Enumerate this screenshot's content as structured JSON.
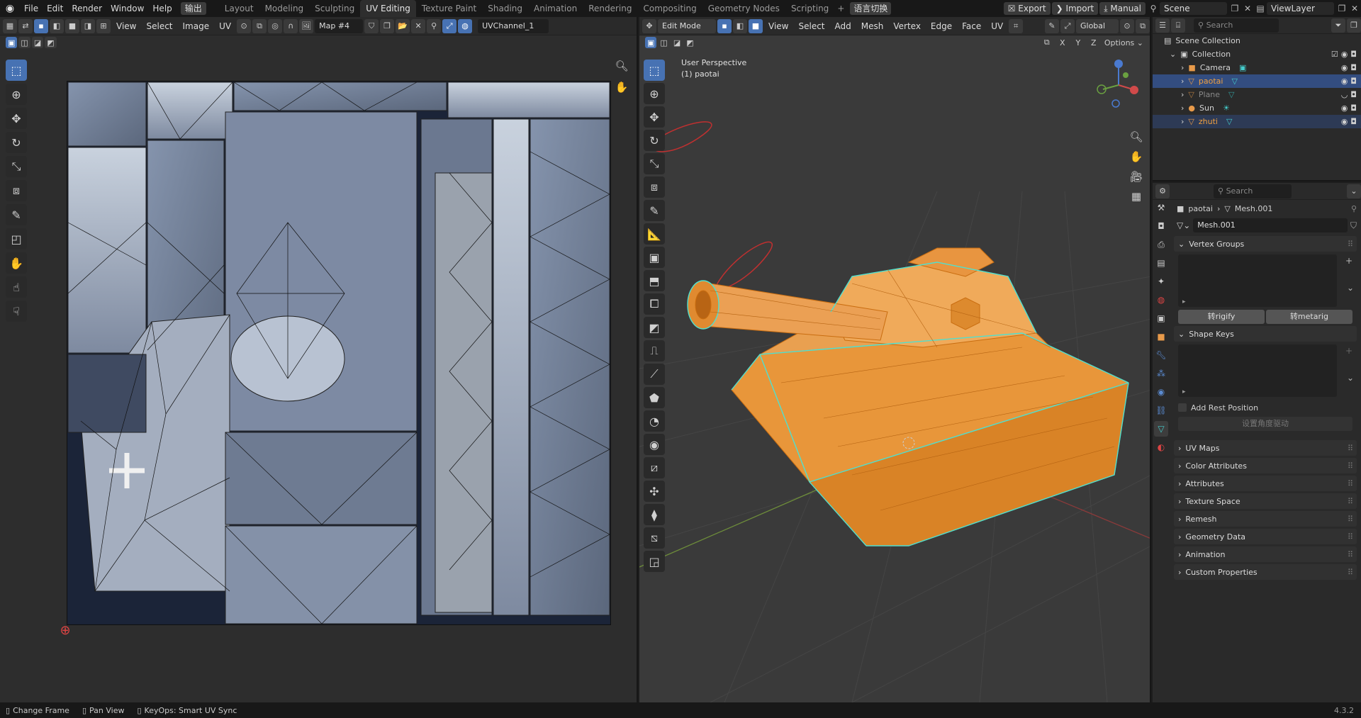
{
  "topbar": {
    "menus": [
      "File",
      "Edit",
      "Render",
      "Window",
      "Help"
    ],
    "special_menu": "输出",
    "workspaces": [
      "Layout",
      "Modeling",
      "Sculpting",
      "UV Editing",
      "Texture Paint",
      "Shading",
      "Animation",
      "Rendering",
      "Compositing",
      "Geometry Nodes",
      "Scripting"
    ],
    "active_workspace": "UV Editing",
    "lang_button": "语言切换",
    "export": "Export",
    "import": "Import",
    "manual": "Manual",
    "scene": "Scene",
    "viewlayer": "ViewLayer"
  },
  "uv_editor": {
    "menus": [
      "View",
      "Select",
      "Image",
      "UV"
    ],
    "image_name": "Map #4",
    "uv_channel": "UVChannel_1"
  },
  "viewport": {
    "mode": "Edit Mode",
    "menus": [
      "View",
      "Select",
      "Add",
      "Mesh",
      "Vertex",
      "Edge",
      "Face",
      "UV"
    ],
    "orientation": "Global",
    "options": "Options",
    "axes": [
      "X",
      "Y",
      "Z"
    ],
    "perspective_label": "User Perspective",
    "object_label": "(1) paotai"
  },
  "outliner": {
    "search_placeholder": "Search",
    "scene_collection": "Scene Collection",
    "collection": "Collection",
    "items": [
      {
        "name": "Camera",
        "selected": false,
        "color": "#d4d4d4"
      },
      {
        "name": "paotai",
        "selected": true,
        "color": "#f0a040"
      },
      {
        "name": "Plane",
        "selected": false,
        "color": "#888888"
      },
      {
        "name": "Sun",
        "selected": false,
        "color": "#d4d4d4"
      },
      {
        "name": "zhuti",
        "selected": false,
        "color": "#f0a040"
      }
    ]
  },
  "properties": {
    "search_placeholder": "Search",
    "breadcrumb_object": "paotai",
    "breadcrumb_mesh": "Mesh.001",
    "mesh_name": "Mesh.001",
    "vertex_groups": "Vertex Groups",
    "btn_rigify": "转rigify",
    "btn_metarig": "转metarig",
    "shape_keys": "Shape Keys",
    "add_rest_position": "Add Rest Position",
    "angle_driver_btn": "设置角度驱动",
    "panels": [
      "UV Maps",
      "Color Attributes",
      "Attributes",
      "Texture Space",
      "Remesh",
      "Geometry Data",
      "Animation",
      "Custom Properties"
    ]
  },
  "statusbar": {
    "change_frame": "Change Frame",
    "pan_view": "Pan View",
    "keyops": "KeyOps: Smart UV Sync",
    "version": "4.3.2"
  },
  "colors": {
    "accent": "#4772b3",
    "mesh_orange": "#e8963a",
    "seam_cyan": "#4fe0d0",
    "uv_blue": "#6c7a90"
  }
}
